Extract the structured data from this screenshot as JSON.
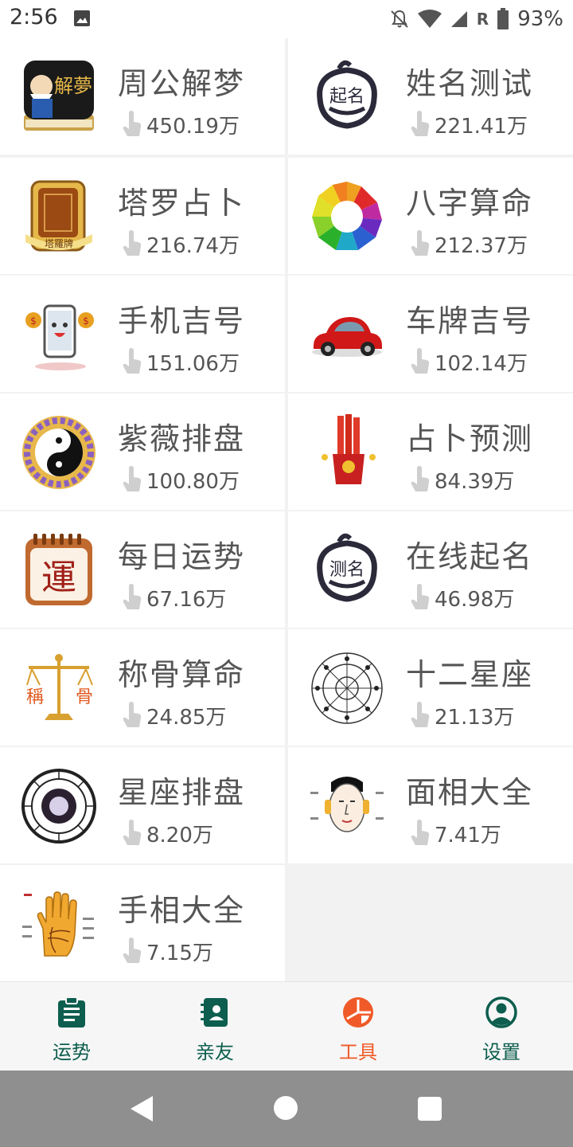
{
  "status_bar": {
    "time": "2:56",
    "carrier_letter": "R",
    "battery": "93%"
  },
  "tools": [
    {
      "title": "周公解梦",
      "count": "450.19万",
      "icon": "dream-book-icon"
    },
    {
      "title": "姓名测试",
      "count": "221.41万",
      "icon": "name-test-face-icon"
    },
    {
      "title": "塔罗占卜",
      "count": "216.74万",
      "icon": "tarot-card-icon"
    },
    {
      "title": "八字算命",
      "count": "212.37万",
      "icon": "bagua-icon"
    },
    {
      "title": "手机吉号",
      "count": "151.06万",
      "icon": "phone-mascot-icon"
    },
    {
      "title": "车牌吉号",
      "count": "102.14万",
      "icon": "red-car-icon"
    },
    {
      "title": "紫薇排盘",
      "count": "100.80万",
      "icon": "yin-yang-icon"
    },
    {
      "title": "占卜预测",
      "count": "84.39万",
      "icon": "divination-sticks-icon"
    },
    {
      "title": "每日运势",
      "count": "67.16万",
      "icon": "daily-fortune-calendar-icon"
    },
    {
      "title": "在线起名",
      "count": "46.98万",
      "icon": "naming-face-icon"
    },
    {
      "title": "称骨算命",
      "count": "24.85万",
      "icon": "bone-scale-icon"
    },
    {
      "title": "十二星座",
      "count": "21.13万",
      "icon": "zodiac-wheel-icon"
    },
    {
      "title": "星座排盘",
      "count": "8.20万",
      "icon": "astrology-chart-icon"
    },
    {
      "title": "面相大全",
      "count": "7.41万",
      "icon": "face-reading-icon"
    },
    {
      "title": "手相大全",
      "count": "7.15万",
      "icon": "palm-reading-icon"
    }
  ],
  "icon_labels": {
    "dream": "解夢",
    "tarot": "塔羅牌",
    "fortune": "運",
    "bone1": "稱",
    "bone2": "骨",
    "name1": "起名",
    "name2": "测名"
  },
  "nav": [
    {
      "label": "运势",
      "icon": "clipboard-icon",
      "active": false
    },
    {
      "label": "亲友",
      "icon": "contacts-book-icon",
      "active": false
    },
    {
      "label": "工具",
      "icon": "tools-pie-icon",
      "active": true
    },
    {
      "label": "设置",
      "icon": "user-circle-icon",
      "active": false
    }
  ],
  "colors": {
    "nav_default": "#0d5e4e",
    "nav_active": "#f05a28"
  }
}
